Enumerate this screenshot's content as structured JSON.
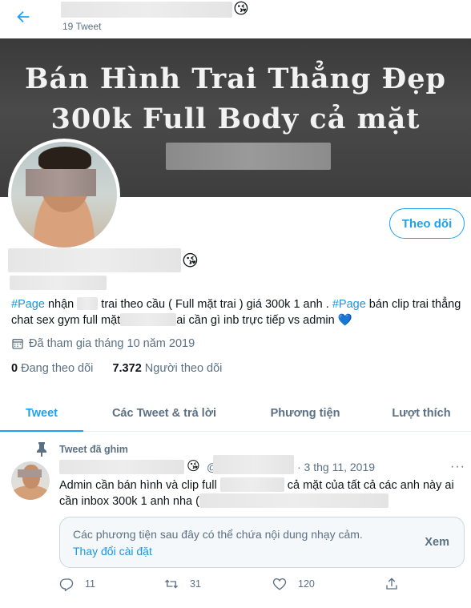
{
  "header": {
    "tweet_count": "19 Tweet",
    "emoji": "😘"
  },
  "banner": {
    "line1": "Bán Hình Trai Thẳng Đẹp",
    "line2": "300k Full Body cả mặt"
  },
  "profile": {
    "follow_label": "Theo dõi",
    "name_emoji": "😘",
    "bio": {
      "tag1": "#Page",
      "t1": " nhận ",
      "t2": " trai theo cầu ( Full mặt trai ) giá 300k 1 anh . ",
      "tag2": "#Page",
      "t3": " bán clip trai thẳng chat sex gym full mặt",
      "t4": "ai cần gì inb trực tiếp vs admin ",
      "heart": "💙"
    },
    "joined": "Đã tham gia tháng 10 năm 2019",
    "following_count": "0",
    "following_label": " Đang theo dõi",
    "followers_count": "7.372",
    "followers_label": " Người theo dõi"
  },
  "tabs": [
    "Tweet",
    "Các Tweet & trả lời",
    "Phương tiện",
    "Lượt thích"
  ],
  "tweet": {
    "pinned_label": "Tweet đã ghim",
    "emoji": "😘",
    "at": "@",
    "date": "· 3 thg 11, 2019",
    "more": "···",
    "text_a": "Admin cần bán hình và clip full ",
    "text_b": " cả mặt của tất cả các anh này ai cần inbox 300k 1 anh nha (",
    "sensitive_text": "Các phương tiện sau đây có thể chứa nội dung nhạy cảm.",
    "sensitive_link": "Thay đổi cài đặt",
    "view_label": "Xem",
    "reply_count": "11",
    "retweet_count": "31",
    "like_count": "120"
  },
  "colors": {
    "accent": "#1da1f2",
    "muted": "#5b7083",
    "banner": "#3f3f3f"
  },
  "icons": [
    "back-arrow-icon",
    "calendar-icon",
    "pin-icon",
    "reply-icon",
    "retweet-icon",
    "like-icon",
    "share-icon"
  ]
}
